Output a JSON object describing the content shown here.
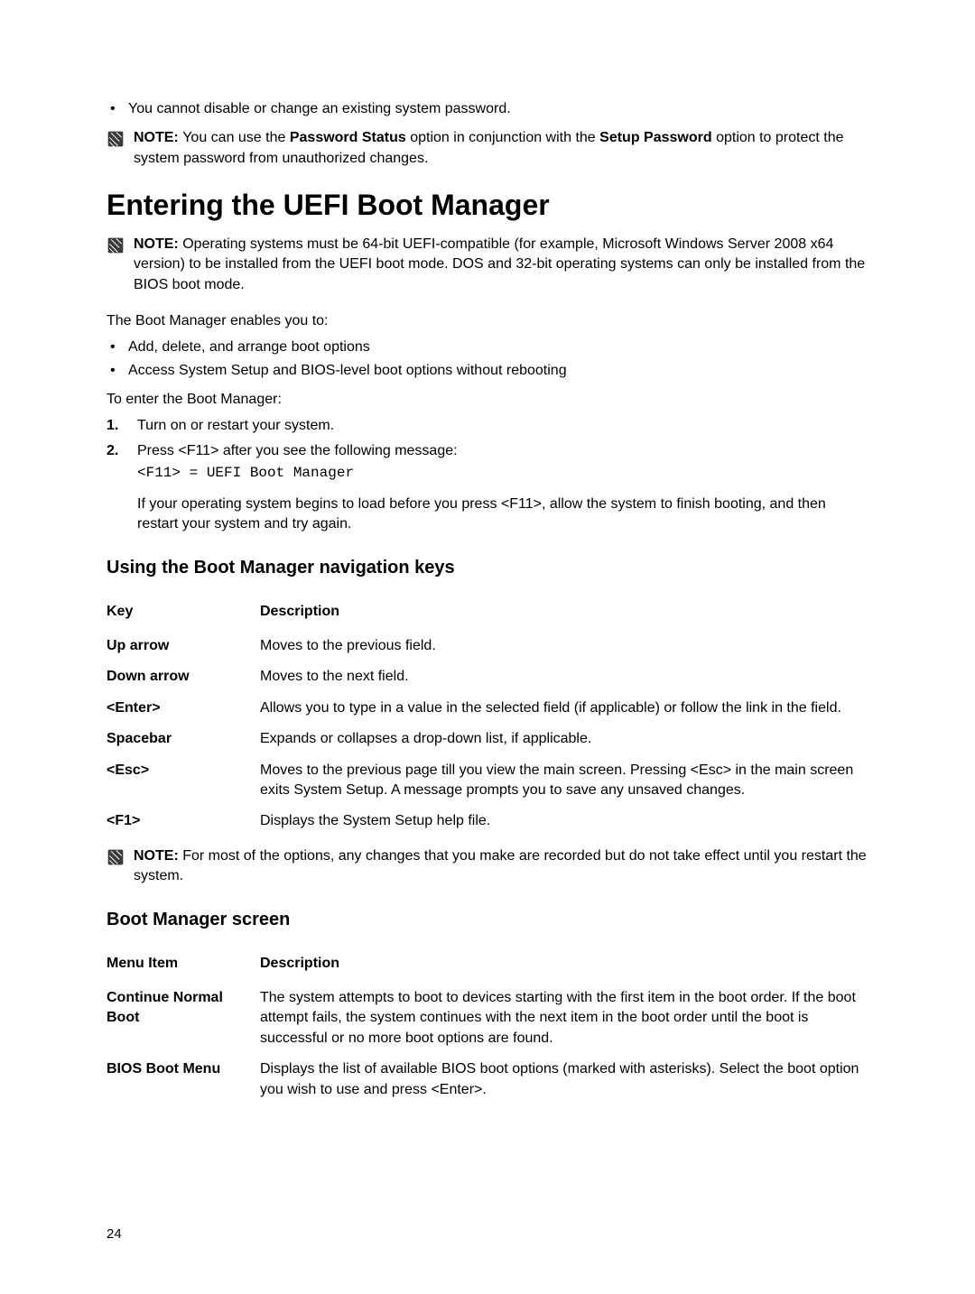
{
  "top_bullet": "You cannot disable or change an existing system password.",
  "note1_prefix": "NOTE: ",
  "note1_part1": "You can use the ",
  "note1_bold1": "Password Status",
  "note1_part2": " option in conjunction with the ",
  "note1_bold2": "Setup Password",
  "note1_part3": " option to protect the system password from unauthorized changes.",
  "h1": "Entering the UEFI Boot Manager",
  "note2_prefix": "NOTE: ",
  "note2_body": "Operating systems must be 64-bit UEFI-compatible (for example, Microsoft Windows Server 2008 x64 version) to be installed from the UEFI boot mode. DOS and 32-bit operating systems can only be installed from the BIOS boot mode.",
  "bm_intro": "The Boot Manager enables you to:",
  "bm_b1": "Add, delete, and arrange boot options",
  "bm_b2": "Access System Setup and BIOS-level boot options without rebooting",
  "enter_intro": "To enter the Boot Manager:",
  "step1_n": "1.",
  "step1": "Turn on or restart your system.",
  "step2_n": "2.",
  "step2": "Press <F11> after you see the following message:",
  "step2_code": "<F11> = UEFI Boot Manager",
  "step2_after": "If your operating system begins to load before you press <F11>, allow the system to finish booting, and then restart your system and try again.",
  "h2_nav": "Using the Boot Manager navigation keys",
  "nav_header_key": "Key",
  "nav_header_desc": "Description",
  "nav": [
    {
      "k": "Up arrow",
      "d": "Moves to the previous field."
    },
    {
      "k": "Down arrow",
      "d": "Moves to the next field."
    },
    {
      "k": "<Enter>",
      "d": "Allows you to type in a value in the selected field (if applicable) or follow the link in the field."
    },
    {
      "k": "Spacebar",
      "d": "Expands or collapses a drop-down list, if applicable."
    },
    {
      "k": "<Esc>",
      "d": "Moves to the previous page till you view the main screen. Pressing <Esc> in the main screen exits System Setup. A message prompts you to save any unsaved changes."
    },
    {
      "k": "<F1>",
      "d": "Displays the System Setup help file."
    }
  ],
  "note3_prefix": "NOTE: ",
  "note3_body": "For most of the options, any changes that you make are recorded but do not take effect until you restart the system.",
  "h2_bms": "Boot Manager screen",
  "bms_header_item": "Menu Item",
  "bms_header_desc": "Description",
  "bms": [
    {
      "k": "Continue Normal Boot",
      "d": "The system attempts to boot to devices starting with the first item in the boot order. If the boot attempt fails, the system continues with the next item in the boot order until the boot is successful or no more boot options are found."
    },
    {
      "k": "BIOS Boot Menu",
      "d": "Displays the list of available BIOS boot options (marked with asterisks). Select the boot option you wish to use and press <Enter>."
    }
  ],
  "page_num": "24"
}
